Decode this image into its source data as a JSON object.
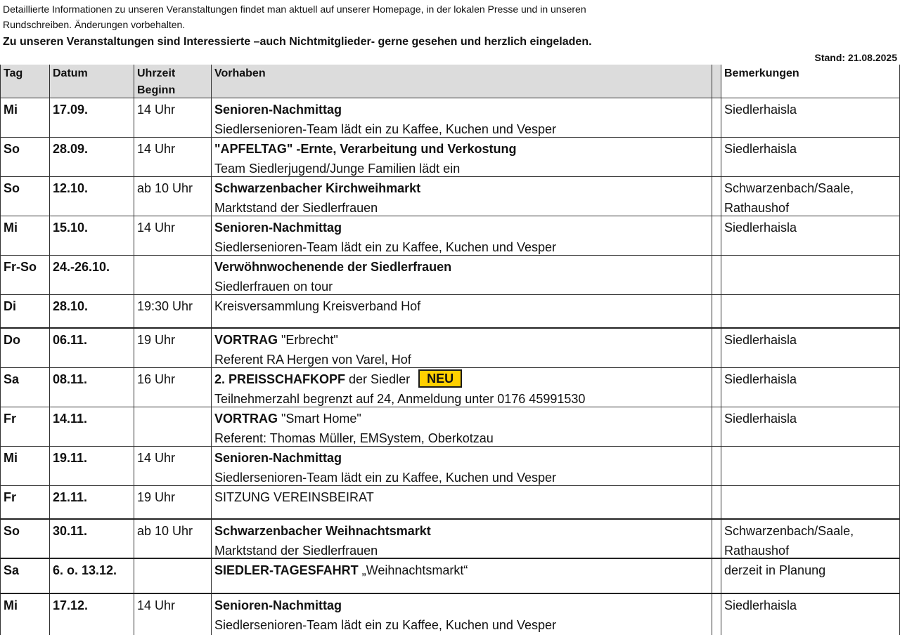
{
  "intro": {
    "line1": "Detaillierte Informationen zu unseren Veranstaltungen findet man aktuell auf unserer Homepage, in der lokalen Presse und in unseren",
    "line2": "Rundschreiben. Änderungen vorbehalten.",
    "notice": "Zu unseren Veranstaltungen sind Interessierte –auch Nichtmitglieder- gerne gesehen und herzlich eingeladen.",
    "stand": "Stand: 21.08.2025"
  },
  "table": {
    "headers": {
      "tag": "Tag",
      "datum": "Datum",
      "uhrzeit_l1": "Uhrzeit",
      "uhrzeit_l2": "Beginn",
      "vorhaben": "Vorhaben",
      "bemerkungen": "Bemerkungen"
    },
    "badge_neu": "NEU",
    "rows": [
      {
        "tag": "Mi",
        "datum": "17.09.",
        "uhrzeit": "14 Uhr",
        "titel": "Senioren-Nachmittag",
        "titel_zusatz": "",
        "untertitel": "Siedlersenioren-Team lädt ein zu Kaffee, Kuchen und Vesper",
        "bem1": "Siedlerhaisla",
        "bem2": ""
      },
      {
        "tag": "So",
        "datum": "28.09.",
        "uhrzeit": "14 Uhr",
        "titel": "\"APFELTAG\" -Ernte, Verarbeitung und Verkostung",
        "titel_zusatz": "",
        "untertitel": "Team Siedlerjugend/Junge Familien lädt ein",
        "bem1": "Siedlerhaisla",
        "bem2": ""
      },
      {
        "tag": "So",
        "datum": "12.10.",
        "uhrzeit": "ab 10 Uhr",
        "titel": "Schwarzenbacher Kirchweihmarkt",
        "titel_zusatz": "",
        "untertitel": "Marktstand der Siedlerfrauen",
        "bem1": "Schwarzenbach/Saale,",
        "bem2": "Rathaushof"
      },
      {
        "tag": "Mi",
        "datum": "15.10.",
        "uhrzeit": "14 Uhr",
        "titel": "Senioren-Nachmittag",
        "titel_zusatz": "",
        "untertitel": "Siedlersenioren-Team lädt ein zu Kaffee, Kuchen und Vesper",
        "bem1": "Siedlerhaisla",
        "bem2": ""
      },
      {
        "tag": "Fr-So",
        "datum": "24.-26.10.",
        "uhrzeit": "",
        "titel": "Verwöhnwochenende der Siedlerfrauen",
        "titel_zusatz": "",
        "untertitel": "Siedlerfrauen on tour",
        "bem1": "",
        "bem2": ""
      },
      {
        "tag": "Di",
        "datum": "28.10.",
        "uhrzeit": "19:30 Uhr",
        "plain": "Kreisversammlung Kreisverband Hof",
        "bem1": "",
        "bem2": ""
      },
      {
        "tag": "Do",
        "datum": "06.11.",
        "uhrzeit": "19 Uhr",
        "titel": "VORTRAG",
        "titel_zusatz": " \"Erbrecht\"",
        "untertitel": "Referent RA Hergen von Varel, Hof",
        "bem1": "Siedlerhaisla",
        "bem2": ""
      },
      {
        "tag": "Sa",
        "datum": "08.11.",
        "uhrzeit": "16 Uhr",
        "titel": "2. PREISSCHAFKOPF",
        "titel_zusatz": " der Siedler",
        "untertitel": "Teilnehmerzahl begrenzt auf 24, Anmeldung unter 0176 45991530",
        "bem1": "Siedlerhaisla",
        "bem2": ""
      },
      {
        "tag": "Fr",
        "datum": "14.11.",
        "uhrzeit": "",
        "titel": "VORTRAG",
        "titel_zusatz": " \"Smart Home\"",
        "untertitel": "Referent: Thomas Müller, EMSystem, Oberkotzau",
        "bem1": "Siedlerhaisla",
        "bem2": ""
      },
      {
        "tag": "Mi",
        "datum": "19.11.",
        "uhrzeit": "14 Uhr",
        "titel": "Senioren-Nachmittag",
        "titel_zusatz": "",
        "untertitel": "Siedlersenioren-Team lädt ein zu Kaffee, Kuchen und Vesper",
        "bem1": "",
        "bem2": ""
      },
      {
        "tag": "Fr",
        "datum": "21.11.",
        "uhrzeit": "19 Uhr",
        "plain": "SITZUNG VEREINSBEIRAT",
        "bem1": "",
        "bem2": ""
      },
      {
        "tag": "So",
        "datum": "30.11.",
        "uhrzeit": "ab 10 Uhr",
        "titel": "Schwarzenbacher Weihnachtsmarkt",
        "titel_zusatz": "",
        "untertitel": "Marktstand der Siedlerfrauen",
        "bem1": "Schwarzenbach/Saale,",
        "bem2": "Rathaushof"
      },
      {
        "tag": "Sa",
        "datum": "6. o. 13.12.",
        "uhrzeit": "",
        "titel": "SIEDLER-TAGESFAHRT",
        "titel_zusatz": " „Weihnachtsmarkt“",
        "untertitel": "",
        "bem1": "derzeit in Planung",
        "bem2": ""
      },
      {
        "tag": "Mi",
        "datum": "17.12.",
        "uhrzeit": "14 Uhr",
        "titel": "Senioren-Nachmittag",
        "titel_zusatz": "",
        "untertitel": "Siedlersenioren-Team lädt ein zu Kaffee, Kuchen und Vesper",
        "bem1": "Siedlerhaisla",
        "bem2": ""
      }
    ]
  }
}
